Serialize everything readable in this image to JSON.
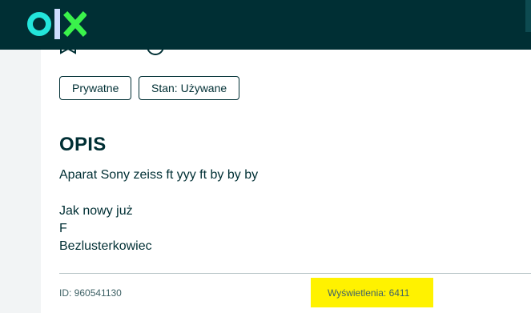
{
  "header": {
    "logo_text": "olx",
    "colors": {
      "bar": "#002f34",
      "logo_o": "#23e5db",
      "logo_l": "#ceddff",
      "logo_x": "#3af24b"
    }
  },
  "ad": {
    "params": [
      {
        "label": "Prywatne"
      },
      {
        "label": "Stan: Używane"
      }
    ],
    "description_title": "OPIS",
    "description_lines": [
      "Aparat Sony zeiss ft yyy ft by by by",
      "Jak nowy już",
      "F",
      "Bezlusterkowiec"
    ],
    "footer": {
      "id_text": "ID: 960541130",
      "views_text": "Wyświetlenia: 6411",
      "highlight_color": "#fff200"
    }
  }
}
